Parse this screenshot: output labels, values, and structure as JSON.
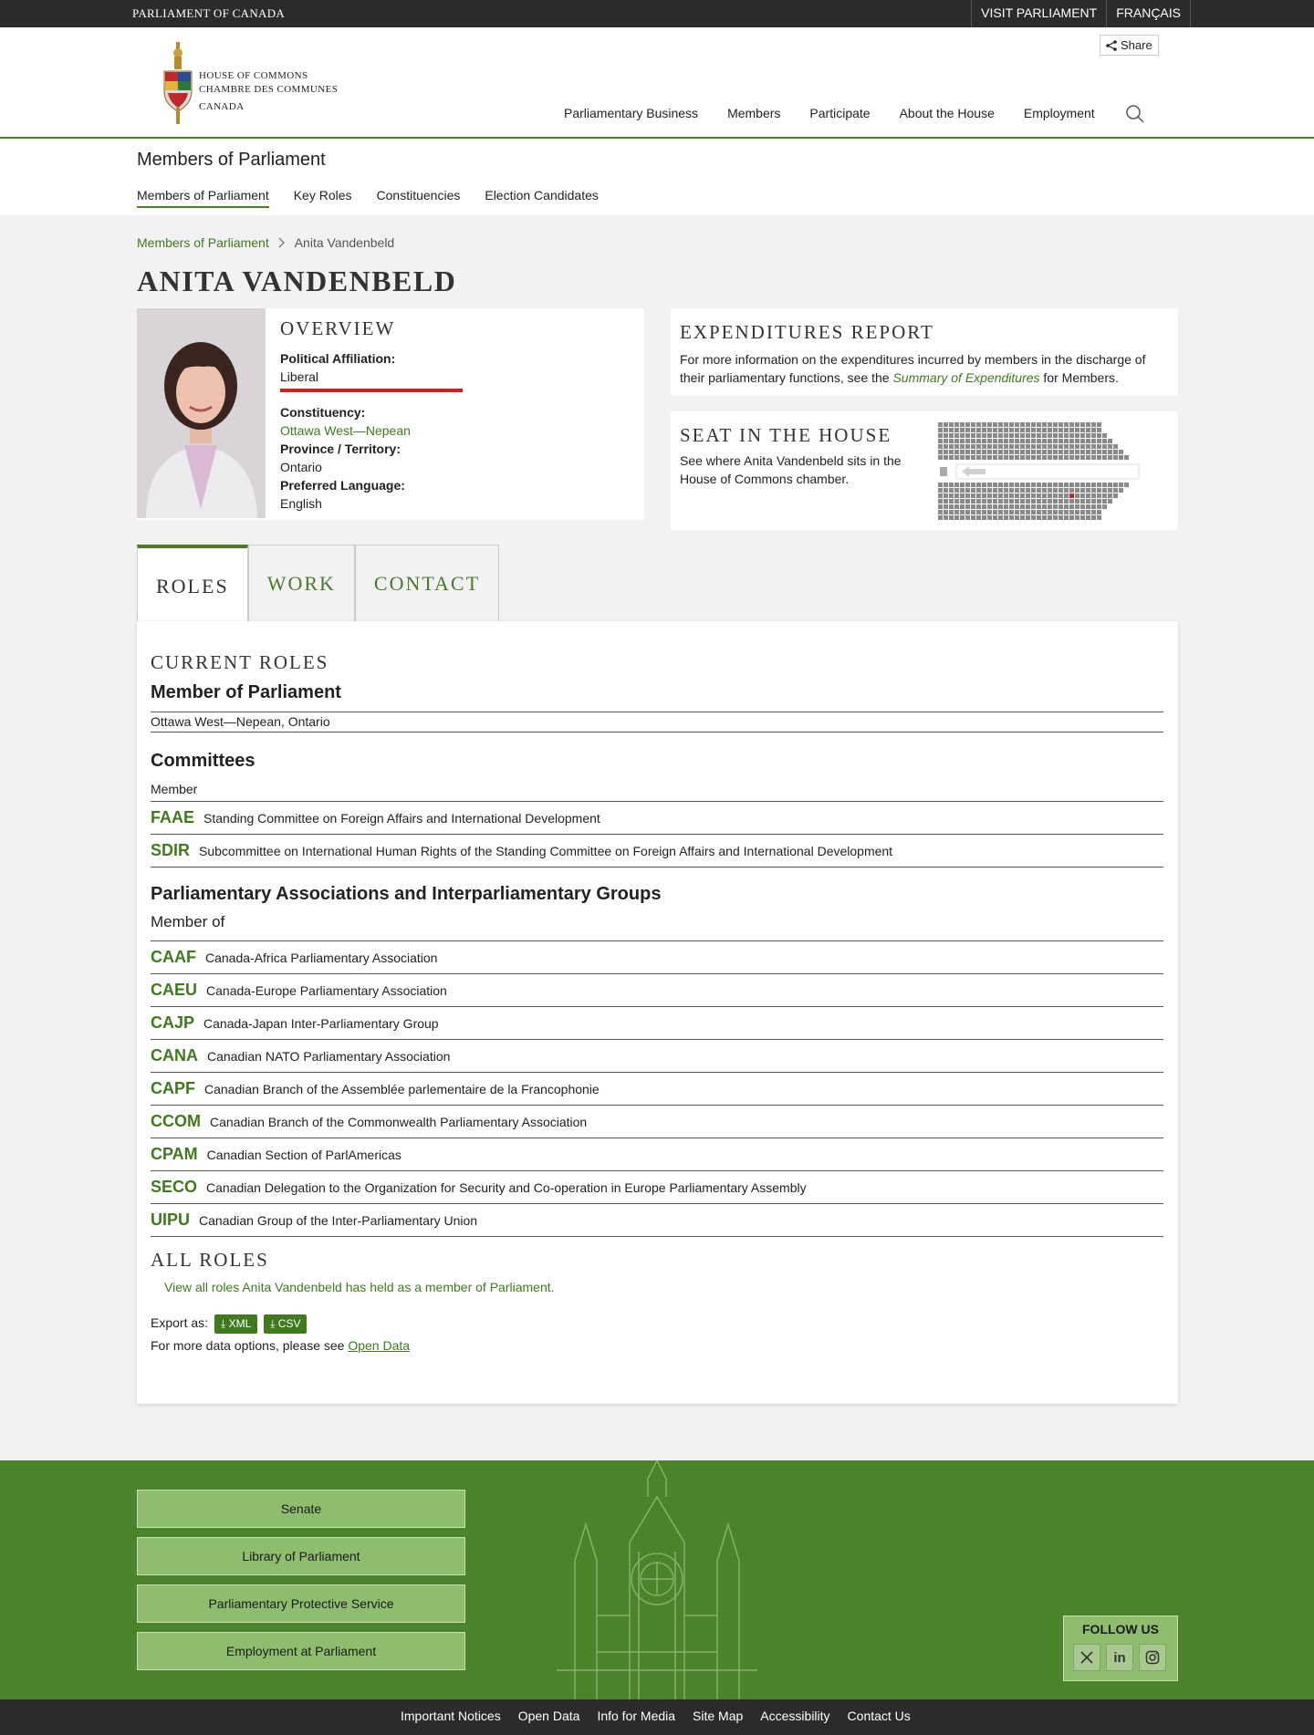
{
  "topbar": {
    "site": "Parliament of Canada",
    "visit": "VISIT PARLIAMENT",
    "french": "FRANÇAIS"
  },
  "header": {
    "logo_lines": [
      "House of Commons",
      "Chambre des communes",
      "Canada"
    ],
    "share": "Share",
    "nav": [
      "Parliamentary Business",
      "Members",
      "Participate",
      "About the House",
      "Employment"
    ]
  },
  "subnav": {
    "title": "Members of Parliament",
    "tabs": [
      "Members of Parliament",
      "Key Roles",
      "Constituencies",
      "Election Candidates"
    ]
  },
  "breadcrumb": {
    "parent": "Members of Parliament",
    "current": "Anita Vandenbeld"
  },
  "member": {
    "name": "Anita Vandenbeld",
    "overview_heading": "Overview",
    "affiliation_label": "Political Affiliation:",
    "affiliation": "Liberal",
    "party_color": "#d71920",
    "constituency_label": "Constituency:",
    "constituency": "Ottawa West—Nepean",
    "province_label": "Province / Territory:",
    "province": "Ontario",
    "language_label": "Preferred Language:",
    "language": "English"
  },
  "expenditures": {
    "heading": "Expenditures Report",
    "text_before": "For more information on the expenditures incurred by members in the discharge of their parliamentary functions, see the ",
    "link": "Summary of Expenditures",
    "text_after": " for Members."
  },
  "seat": {
    "heading": "Seat in the House",
    "text": "See where Anita Vandenbeld sits in the House of Commons chamber."
  },
  "tabs": [
    "Roles",
    "Work",
    "Contact"
  ],
  "roles": {
    "current_heading": "Current Roles",
    "mp_heading": "Member of Parliament",
    "mp_riding": "Ottawa West—Nepean, Ontario",
    "committees_heading": "Committees",
    "committees_role": "Member",
    "committees": [
      {
        "code": "FAAE",
        "name": "Standing Committee on Foreign Affairs and International Development"
      },
      {
        "code": "SDIR",
        "name": "Subcommittee on International Human Rights of the Standing Committee on Foreign Affairs and International Development"
      }
    ],
    "assoc_heading": "Parliamentary Associations and Interparliamentary Groups",
    "assoc_role": "Member of",
    "associations": [
      {
        "code": "CAAF",
        "name": "Canada-Africa Parliamentary Association"
      },
      {
        "code": "CAEU",
        "name": "Canada-Europe Parliamentary Association"
      },
      {
        "code": "CAJP",
        "name": "Canada-Japan Inter-Parliamentary Group"
      },
      {
        "code": "CANA",
        "name": "Canadian NATO Parliamentary Association"
      },
      {
        "code": "CAPF",
        "name": "Canadian Branch of the Assemblée parlementaire de la Francophonie"
      },
      {
        "code": "CCOM",
        "name": "Canadian Branch of the Commonwealth Parliamentary Association"
      },
      {
        "code": "CPAM",
        "name": "Canadian Section of ParlAmericas"
      },
      {
        "code": "SECO",
        "name": "Canadian Delegation to the Organization for Security and Co-operation in Europe Parliamentary Assembly"
      },
      {
        "code": "UIPU",
        "name": "Canadian Group of the Inter-Parliamentary Union"
      }
    ],
    "all_heading": "All Roles",
    "all_link": "View all roles Anita Vandenbeld has held as a member of Parliament.",
    "export_label": "Export as:",
    "export_xml": "XML",
    "export_csv": "CSV",
    "more_data": "For more data options, please see ",
    "open_data": "Open Data"
  },
  "footer": {
    "buttons": [
      "Senate",
      "Library of Parliament",
      "Parliamentary Protective Service",
      "Employment at Parliament"
    ],
    "follow": "FOLLOW US",
    "social": [
      "x-icon",
      "linkedin-icon",
      "instagram-icon"
    ],
    "links": [
      "Important Notices",
      "Open Data",
      "Info for Media",
      "Site Map",
      "Accessibility",
      "Contact Us"
    ]
  }
}
